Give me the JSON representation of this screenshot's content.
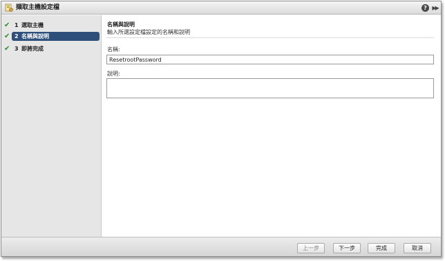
{
  "window": {
    "title": "擷取主機設定檔",
    "help_label": "?",
    "expand_label": "▶▶"
  },
  "steps": [
    {
      "check": "✔",
      "num": "1",
      "label": "選取主機",
      "state": "done"
    },
    {
      "check": "✔",
      "num": "2",
      "label": "名稱與說明",
      "state": "active"
    },
    {
      "check": "✔",
      "num": "3",
      "label": "即將完成",
      "state": "done"
    }
  ],
  "content": {
    "title": "名稱與說明",
    "subtitle": "輸入所選設定檔設定的名稱和說明",
    "name_label": "名稱:",
    "name_value": "ResetrootPassword",
    "description_label": "說明:",
    "description_value": ""
  },
  "footer": {
    "back_label": "上一步",
    "next_label": "下一步",
    "finish_label": "完成",
    "cancel_label": "取消"
  },
  "colors": {
    "active_step": "#2d4f7a",
    "check": "#2e8b2e"
  }
}
